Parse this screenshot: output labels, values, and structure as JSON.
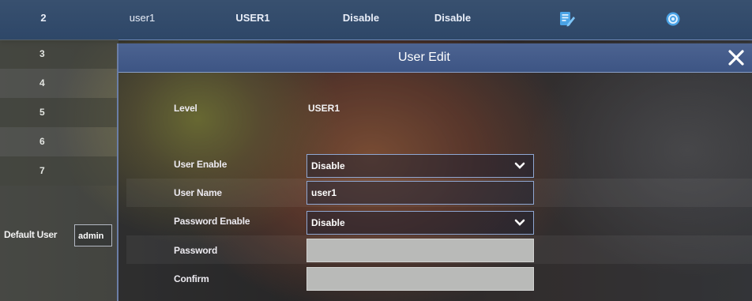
{
  "top_row": {
    "index": "2",
    "name": "user1",
    "level": "USER1",
    "user_enable": "Disable",
    "password_enable": "Disable",
    "edit_icon": "edit-icon",
    "settings_icon": "gear-icon"
  },
  "left_list": {
    "rows": [
      "3",
      "4",
      "5",
      "6",
      "7"
    ],
    "default_user_label": "Default User",
    "default_user_value": "admin"
  },
  "dialog": {
    "title": "User Edit",
    "close_icon": "close-icon",
    "level_label": "Level",
    "level_value": "USER1",
    "user_enable_label": "User Enable",
    "user_enable_value": "Disable",
    "user_name_label": "User Name",
    "user_name_value": "user1",
    "password_enable_label": "Password Enable",
    "password_enable_value": "Disable",
    "password_label": "Password",
    "password_value": "",
    "confirm_label": "Confirm",
    "confirm_value": ""
  },
  "colors": {
    "header_blue": "#38506f",
    "dialog_title_blue": "#4c6391",
    "field_border": "#8fa7d2",
    "blank_field": "#b9bab8"
  }
}
